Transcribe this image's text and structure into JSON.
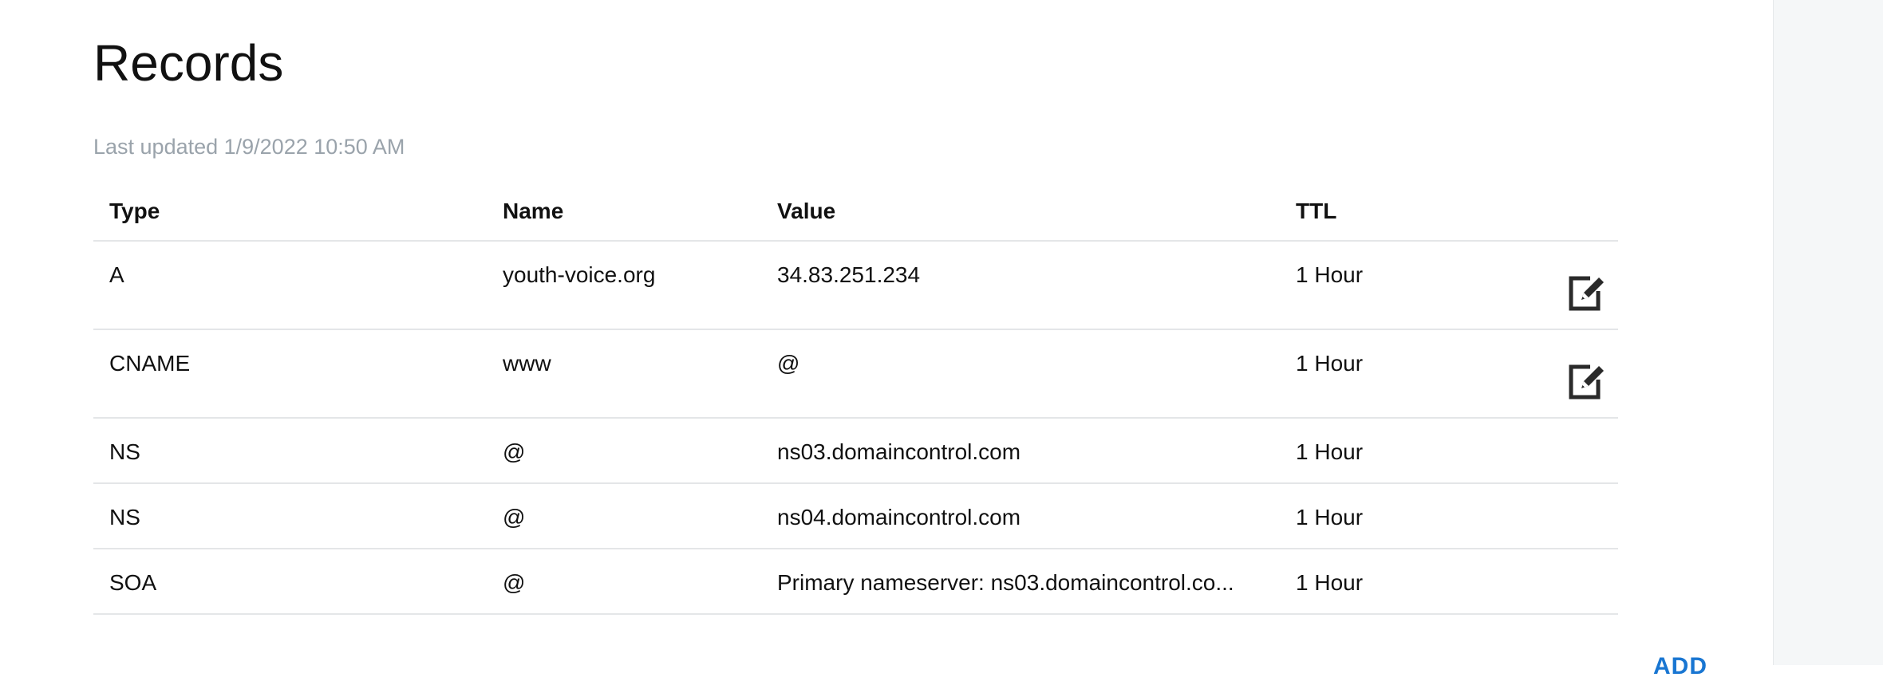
{
  "records": {
    "title": "Records",
    "last_updated": "Last updated 1/9/2022 10:50 AM",
    "columns": {
      "type": "Type",
      "name": "Name",
      "value": "Value",
      "ttl": "TTL"
    },
    "rows": [
      {
        "type": "A",
        "name": "youth-voice.org",
        "value": "34.83.251.234",
        "ttl": "1 Hour",
        "editable": true
      },
      {
        "type": "CNAME",
        "name": "www",
        "value": "@",
        "ttl": "1 Hour",
        "editable": true
      },
      {
        "type": "NS",
        "name": "@",
        "value": "ns03.domaincontrol.com",
        "ttl": "1 Hour",
        "editable": false
      },
      {
        "type": "NS",
        "name": "@",
        "value": "ns04.domaincontrol.com",
        "ttl": "1 Hour",
        "editable": false
      },
      {
        "type": "SOA",
        "name": "@",
        "value": "Primary nameserver: ns03.domaincontrol.co...",
        "ttl": "1 Hour",
        "editable": false
      }
    ],
    "edit_icon": "edit-icon",
    "add_label": "ADD"
  },
  "colors": {
    "accent": "#1976d2",
    "muted_text": "#9aa3ab",
    "divider": "#e4e6e8",
    "side_panel": "#f5f7f8"
  }
}
